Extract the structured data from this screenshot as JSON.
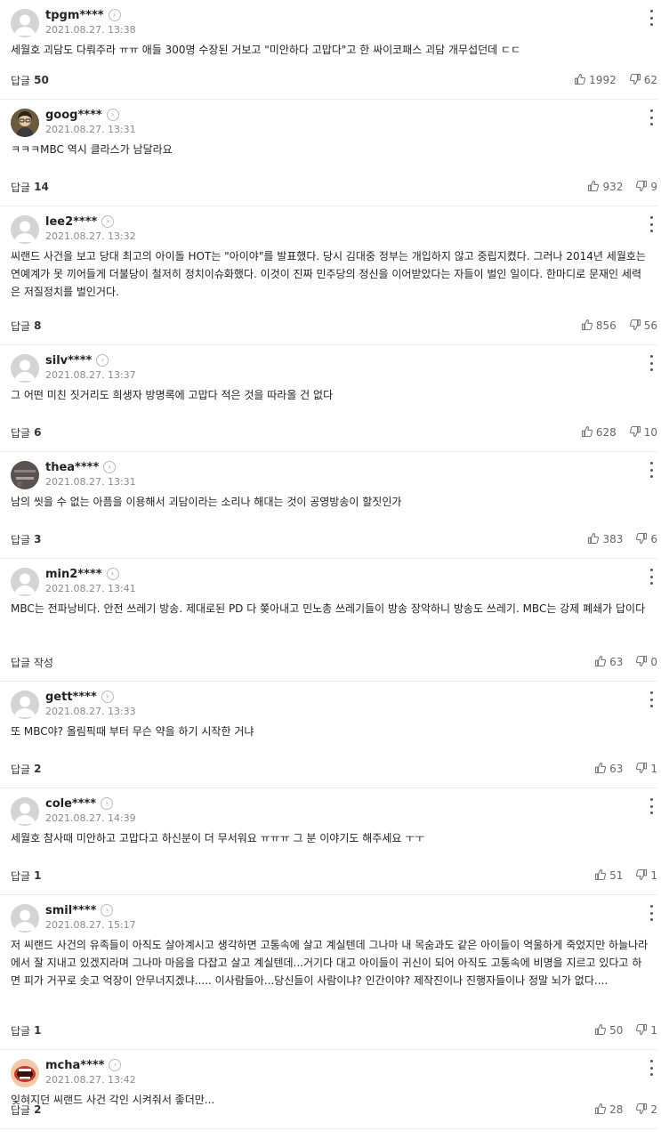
{
  "comments": [
    {
      "user": "tpgm****",
      "date": "2021.08.27. 13:38",
      "text": "세월호 괴담도 다뤄주라 ㅠㅠ 애들 300명 수장된 거보고 \"미안하다 고맙다\"고 한 싸이코패스 괴담 개무섭던데 ㄷㄷ",
      "reply_label": "답글",
      "reply_count": "50",
      "likes": "1992",
      "dislikes": "62",
      "avatar": "default"
    },
    {
      "user": "goog****",
      "date": "2021.08.27. 13:31",
      "text": "ㅋㅋㅋMBC 역시 클라스가 남달라요",
      "reply_label": "답글",
      "reply_count": "14",
      "likes": "932",
      "dislikes": "9",
      "avatar": "photo"
    },
    {
      "user": "lee2****",
      "date": "2021.08.27. 13:32",
      "text": "씨랜드 사건을 보고 당대 최고의 아이돌 HOT는 \"아이야\"를 발표했다. 당시 김대중 정부는 개입하지 않고 중립지켰다. 그러나 2014년 세월호는 연예계가 못 끼어들게 더불당이 철저히 정치이슈화했다. 이것이 진짜 민주당의 정신을 이어받았다는 자들이 벌인 일이다. 한마디로 문재인 세력은 저질정치를 벌인거다.",
      "reply_label": "답글",
      "reply_count": "8",
      "likes": "856",
      "dislikes": "56",
      "avatar": "default"
    },
    {
      "user": "silv****",
      "date": "2021.08.27. 13:37",
      "text": "그 어떤 미친 짓거리도 희생자 방명록에 고맙다 적은 것을 따라올 건 없다",
      "reply_label": "답글",
      "reply_count": "6",
      "likes": "628",
      "dislikes": "10",
      "avatar": "default"
    },
    {
      "user": "thea****",
      "date": "2021.08.27. 13:31",
      "text": "남의 씻을 수 없는 아픔을 이용해서 괴담이라는 소리나 해대는 것이 공영방송이 할짓인가",
      "reply_label": "답글",
      "reply_count": "3",
      "likes": "383",
      "dislikes": "6",
      "avatar": "dark"
    },
    {
      "user": "min2****",
      "date": "2021.08.27. 13:41",
      "text": "MBC는 전파낭비다. 안전 쓰레기 방송. 제대로된 PD 다 쫒아내고 민노총 쓰레기들이 방송 장악하니 방송도 쓰레기. MBC는 강제 폐쇄가 답이다",
      "reply_label": "답글 작성",
      "reply_count": "",
      "likes": "63",
      "dislikes": "0",
      "avatar": "default"
    },
    {
      "user": "gett****",
      "date": "2021.08.27. 13:33",
      "text": "또 MBC야? 올림픽때 부터 무슨 약을 하기 시작한 거냐",
      "reply_label": "답글",
      "reply_count": "2",
      "likes": "63",
      "dislikes": "1",
      "avatar": "default"
    },
    {
      "user": "cole****",
      "date": "2021.08.27. 14:39",
      "text": "세월호 참사때 미안하고 고맙다고 하신분이 더 무서워요 ㅠㅠㅠ 그 분 이야기도 해주세요 ㅜㅜ",
      "reply_label": "답글",
      "reply_count": "1",
      "likes": "51",
      "dislikes": "1",
      "avatar": "default"
    },
    {
      "user": "smil****",
      "date": "2021.08.27. 15:17",
      "text": "저 씨랜드 사건의 유족들이 아직도 살아계시고 생각하면 고통속에 살고 계실텐데 그나마 내 목숨과도 같은 아이들이 억울하게 죽었지만 하늘나라에서 잘 지내고 있겠지라며 그나마 마음을 다잡고 살고 계실텐데...거기다 대고 아이들이 귀신이 되어 아직도 고통속에 비명을 지르고 있다고 하면 피가 거꾸로 솟고 억장이 안무너지겠냐..... 이사람들아...당신들이 사람이냐? 인간이야? 제작진이나 진행자들이나 정말 뇌가 없다....",
      "reply_label": "답글",
      "reply_count": "1",
      "likes": "50",
      "dislikes": "1",
      "avatar": "default"
    },
    {
      "user": "mcha****",
      "date": "2021.08.27. 13:42",
      "text": "잊혀지던 씨랜드 사건 각인 시켜줘서 좋더만...",
      "reply_label": "답글",
      "reply_count": "2",
      "likes": "28",
      "dislikes": "2",
      "avatar": "mouth"
    }
  ]
}
